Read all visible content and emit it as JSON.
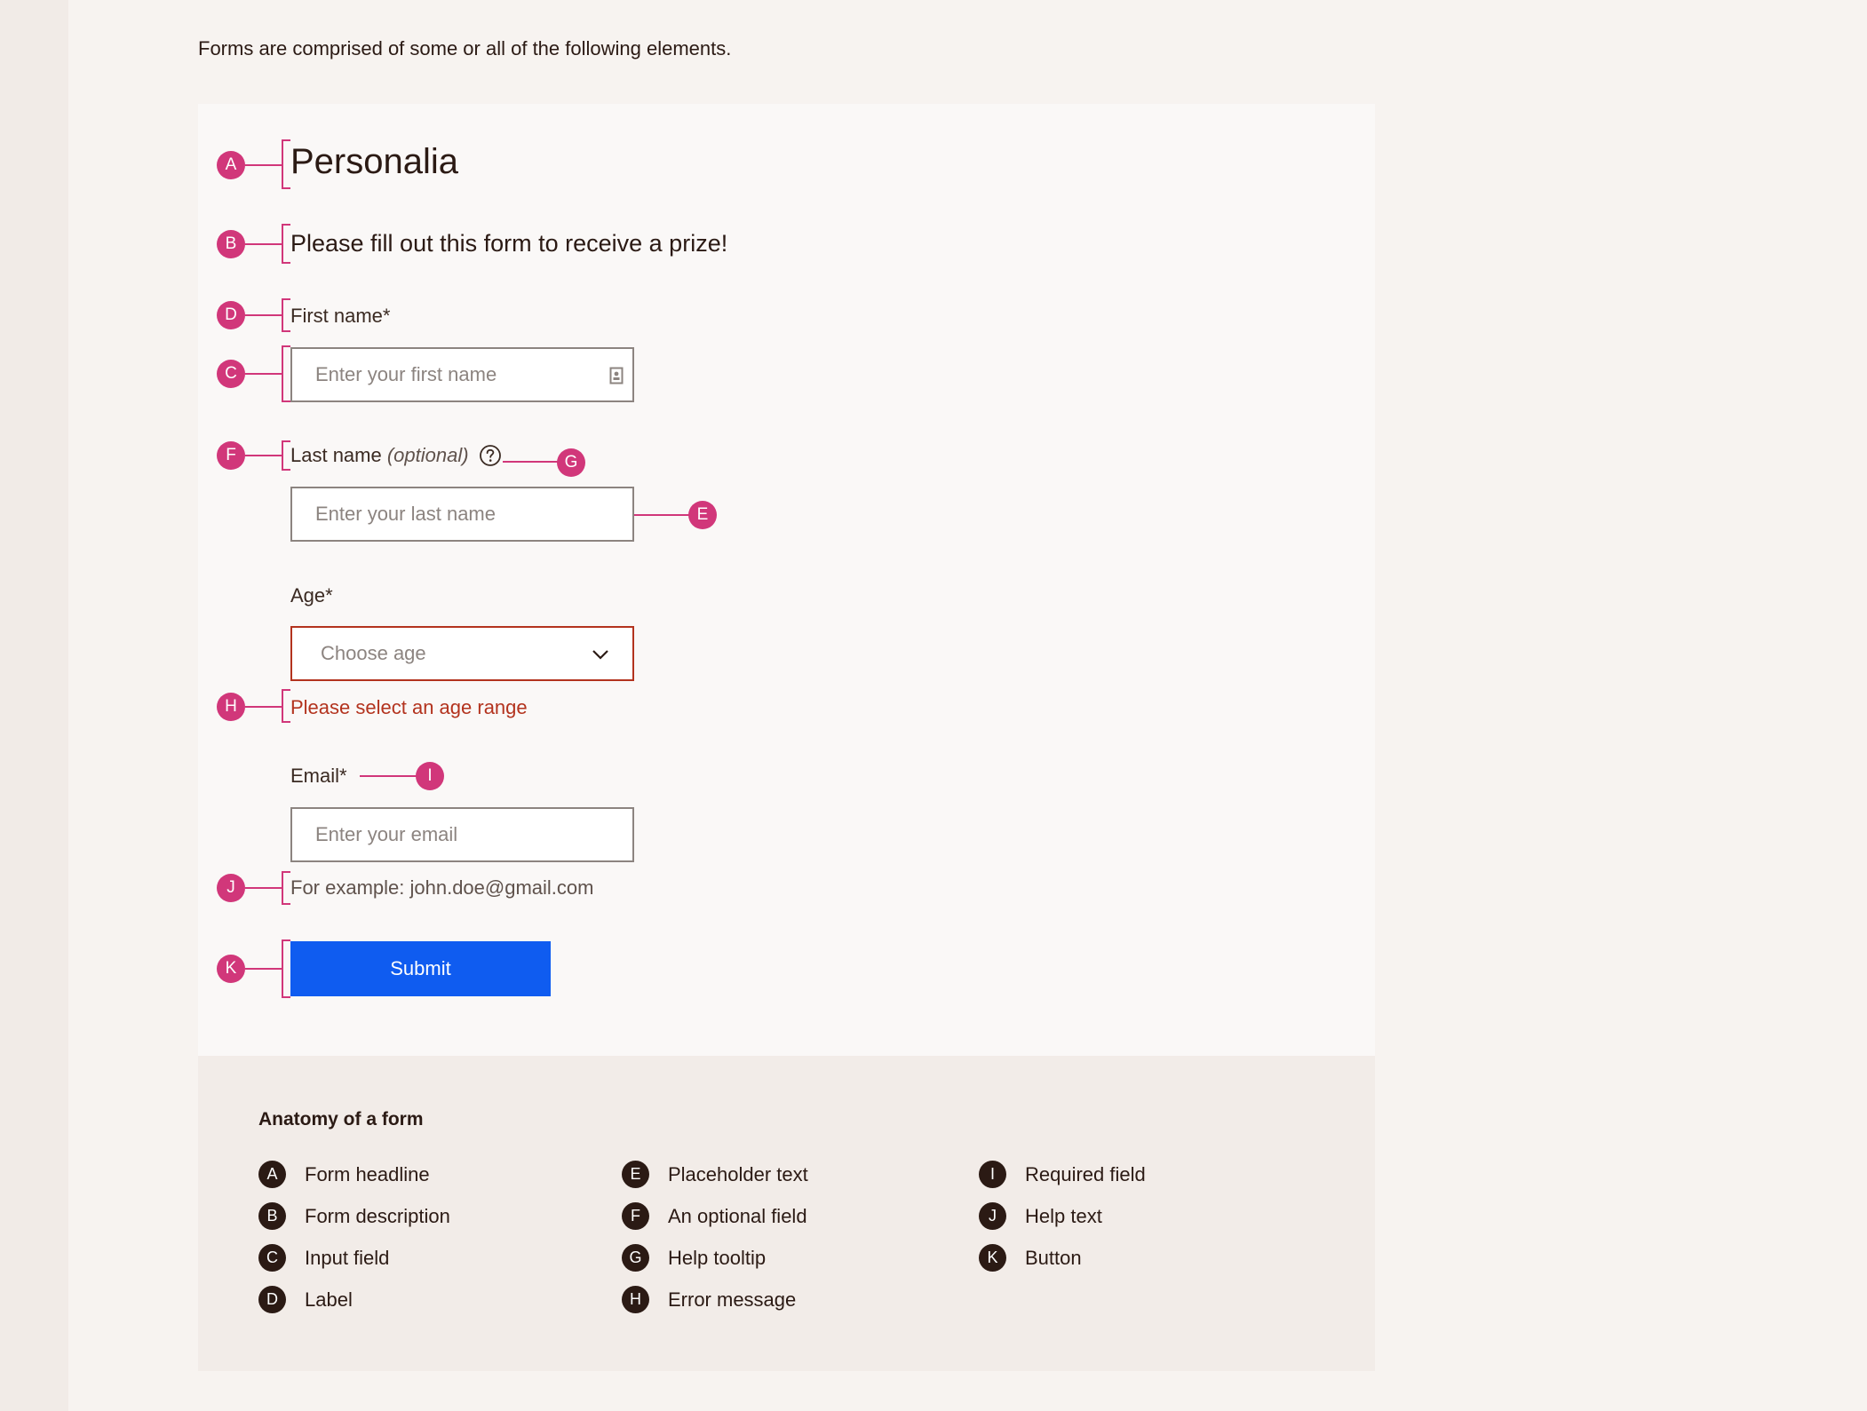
{
  "intro": "Forms are comprised of some or all of the following elements.",
  "form": {
    "headline": "Personalia",
    "description": "Please fill out this form to receive a prize!",
    "first_name": {
      "label": "First name",
      "required_mark": "*",
      "placeholder": "Enter your first name"
    },
    "last_name": {
      "label": "Last name",
      "optional": "(optional)",
      "placeholder": "Enter your last name"
    },
    "age": {
      "label": "Age",
      "required_mark": "*",
      "placeholder": "Choose age",
      "error": "Please select an age range"
    },
    "email": {
      "label": "Email",
      "required_mark": "*",
      "placeholder": "Enter your email",
      "help": "For example: john.doe@gmail.com"
    },
    "submit_label": "Submit"
  },
  "markers": {
    "a": "A",
    "b": "B",
    "c": "C",
    "d": "D",
    "e": "E",
    "f": "F",
    "g": "G",
    "h": "H",
    "i": "I",
    "j": "J",
    "k": "K"
  },
  "legend": {
    "title": "Anatomy of a form",
    "items": [
      {
        "key": "A",
        "label": "Form headline"
      },
      {
        "key": "B",
        "label": "Form description"
      },
      {
        "key": "C",
        "label": "Input field"
      },
      {
        "key": "D",
        "label": "Label"
      },
      {
        "key": "E",
        "label": "Placeholder text"
      },
      {
        "key": "F",
        "label": "An optional field"
      },
      {
        "key": "G",
        "label": "Help tooltip"
      },
      {
        "key": "H",
        "label": "Error message"
      },
      {
        "key": "I",
        "label": "Required field"
      },
      {
        "key": "J",
        "label": "Help text"
      },
      {
        "key": "K",
        "label": "Button"
      }
    ]
  },
  "colors": {
    "annotation": "#d1377a",
    "error": "#b3331e",
    "primary_button": "#0f5cf0",
    "text": "#2b1a14"
  },
  "icons": {
    "first_name_field": "contact-card-icon",
    "last_name_label": "help-circle-icon",
    "age_select": "chevron-down-icon"
  }
}
